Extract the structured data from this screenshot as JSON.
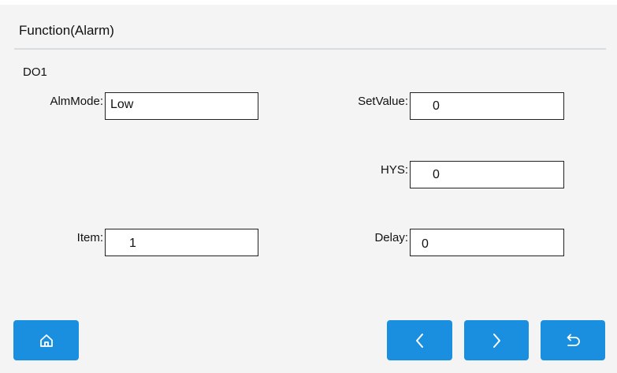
{
  "header": {
    "title": "Function(Alarm)"
  },
  "section": {
    "name": "DO1"
  },
  "fields": {
    "alm_mode": {
      "label": "AlmMode:",
      "value": "Low"
    },
    "set_value": {
      "label": "SetValue:",
      "value": "0"
    },
    "hys": {
      "label": "HYS:",
      "value": "0"
    },
    "item": {
      "label": "Item:",
      "value": "1"
    },
    "delay": {
      "label": "Delay:",
      "value": "0"
    }
  },
  "nav": {
    "home_icon": "home-icon",
    "prev_icon": "chevron-left-icon",
    "next_icon": "chevron-right-icon",
    "back_icon": "return-icon"
  },
  "colors": {
    "button": "#1a8fe0",
    "icon": "#ffffff",
    "divider": "#d9dde0",
    "background": "#f4f4f4"
  }
}
